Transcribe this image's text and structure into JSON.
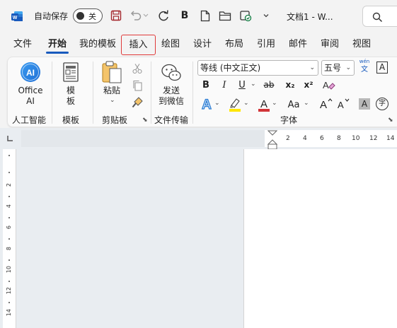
{
  "titlebar": {
    "autosave_label": "自动保存",
    "autosave_state": "关",
    "doc_title": "文档1 - W..."
  },
  "tabs": [
    "文件",
    "开始",
    "我的模板",
    "插入",
    "绘图",
    "设计",
    "布局",
    "引用",
    "邮件",
    "审阅",
    "视图"
  ],
  "active_tab": "开始",
  "highlighted_tab": "插入",
  "ribbon": {
    "office_ai": {
      "line1": "Office",
      "line2": "AI",
      "group": "人工智能"
    },
    "template": {
      "line1": "模",
      "line2": "板",
      "group": "模板"
    },
    "clipboard": {
      "paste": "粘贴",
      "group": "剪贴板"
    },
    "file_transfer": {
      "line1": "发送",
      "line2": "到微信",
      "group": "文件传输"
    },
    "font": {
      "font_name": "等线 (中文正文)",
      "font_size": "五号",
      "group": "字体",
      "phonetic_top": "wén",
      "phonetic_bottom": "文",
      "bold": "B",
      "italic": "I",
      "underline": "U",
      "strike": "ab",
      "subscript": "x₂",
      "superscript": "x²",
      "font_color_letter": "A",
      "change_case": "Aa",
      "grow": "A",
      "shrink": "A",
      "shade": "A",
      "enclose": "字",
      "border_char": "A",
      "font_color_hex": "#d13438",
      "highlight_hex": "#ffe600"
    }
  },
  "ruler": {
    "h_ticks": [
      "2",
      "4",
      "6",
      "8",
      "10",
      "12",
      "14"
    ],
    "v_ticks": [
      "2",
      "4",
      "6",
      "8",
      "10",
      "12",
      "14"
    ]
  },
  "colors": {
    "accent": "#185abd",
    "highlight_border": "#e03a3a"
  }
}
